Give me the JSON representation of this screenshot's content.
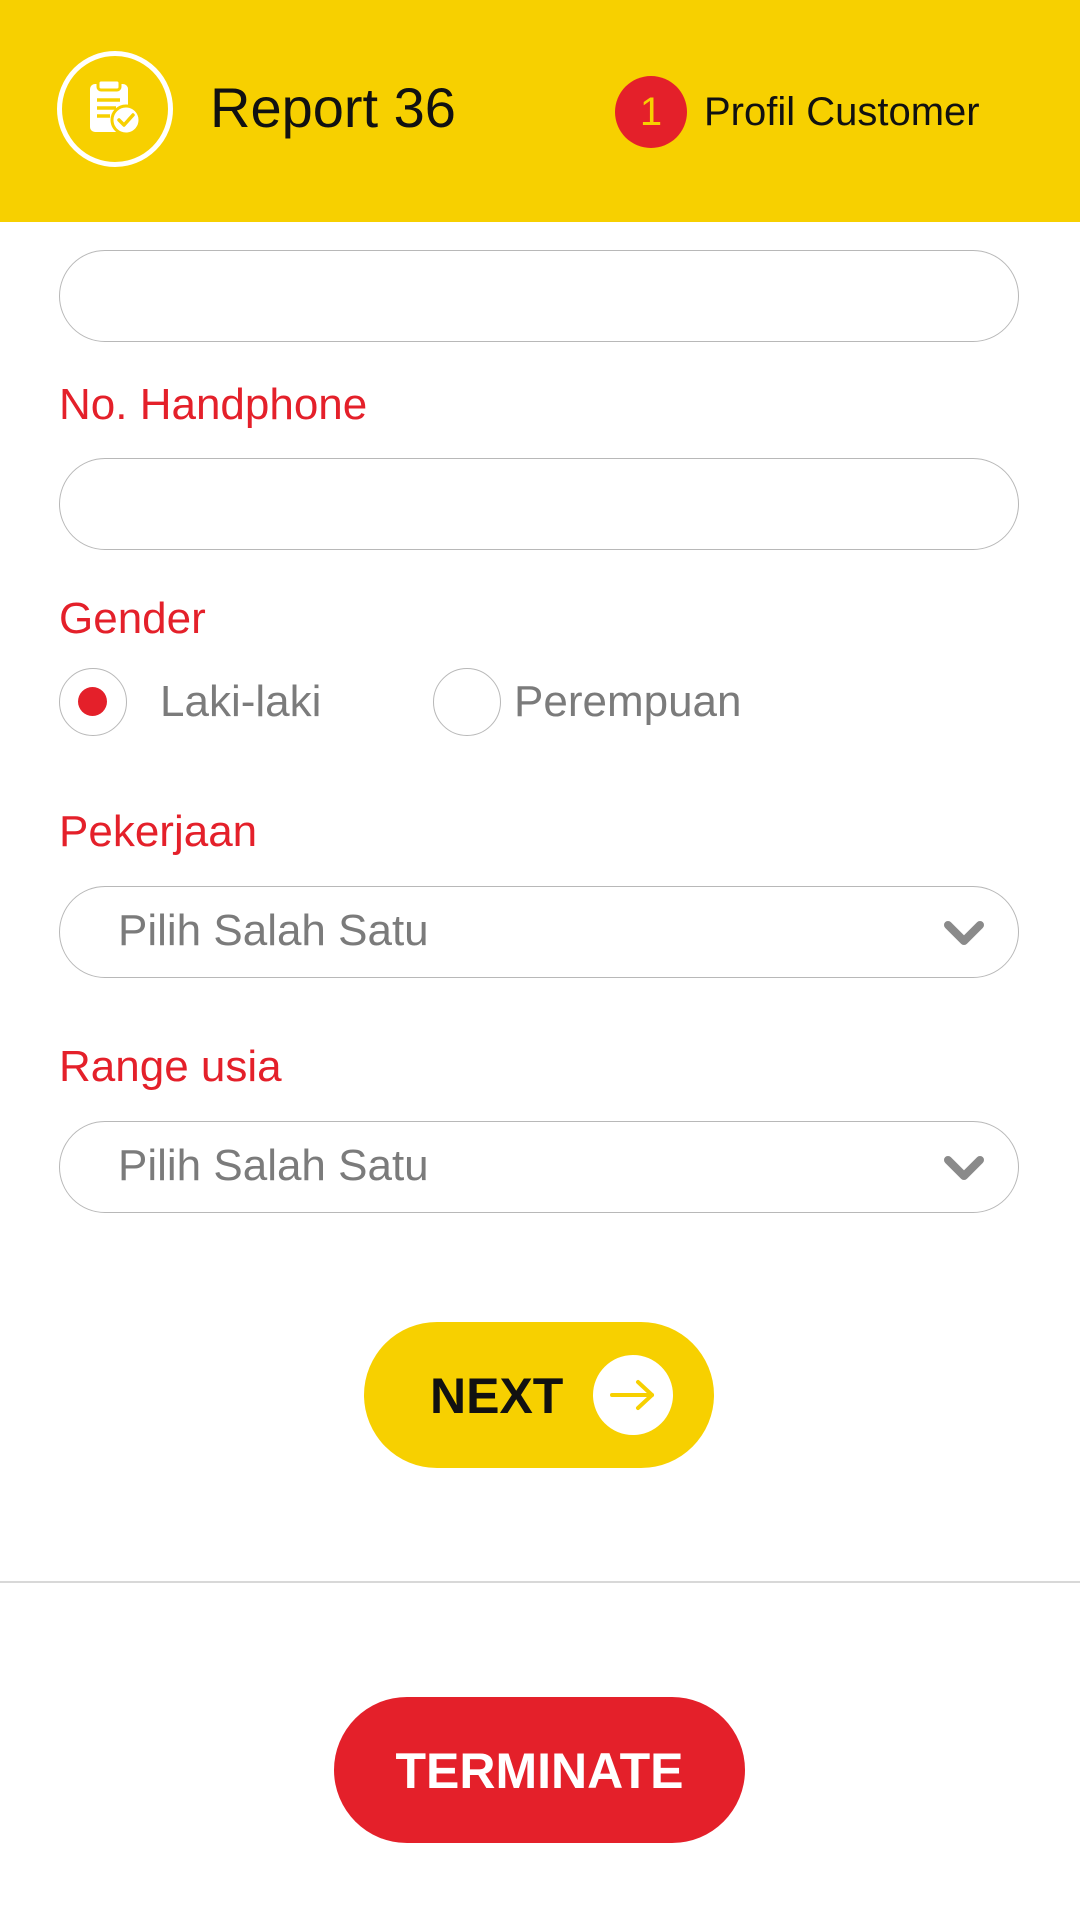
{
  "header": {
    "title": "Report 36",
    "step_number": "1",
    "step_label": "Profil Customer",
    "logo_icon": "report-check-icon"
  },
  "form": {
    "top_field": {
      "value": "",
      "placeholder": ""
    },
    "phone": {
      "label": "No. Handphone",
      "value": "",
      "placeholder": ""
    },
    "gender": {
      "label": "Gender",
      "options": [
        {
          "label": "Laki-laki",
          "selected": true
        },
        {
          "label": "Perempuan",
          "selected": false
        }
      ]
    },
    "pekerjaan": {
      "label": "Pekerjaan",
      "selected": "Pilih Salah Satu"
    },
    "range_usia": {
      "label": "Range usia",
      "selected": "Pilih Salah Satu"
    }
  },
  "actions": {
    "next_label": "NEXT",
    "terminate_label": "TERMINATE"
  },
  "colors": {
    "brand_yellow": "#f7d000",
    "brand_red": "#e4202a",
    "border_gray": "#b8b8b8",
    "text_gray": "#7b7b7b"
  }
}
